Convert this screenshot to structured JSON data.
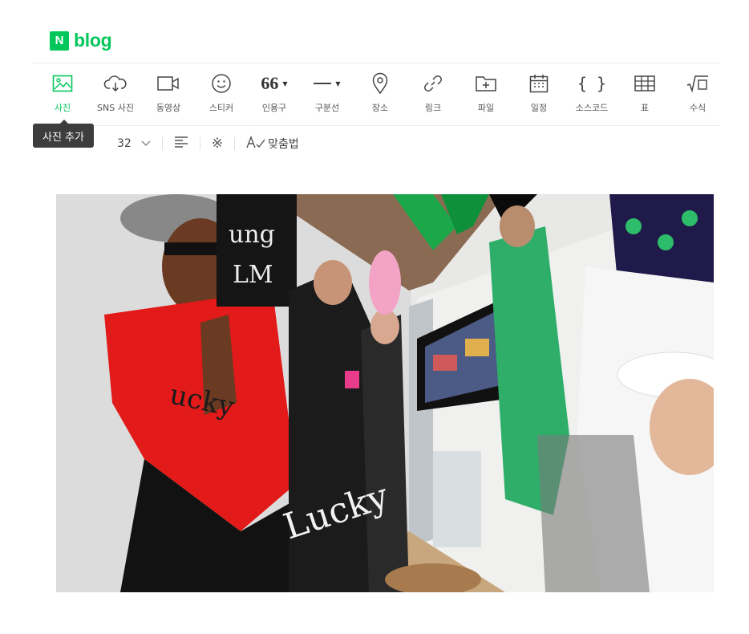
{
  "header": {
    "logo_mark": "N",
    "logo_text": "blog"
  },
  "toolbar": {
    "items": [
      {
        "label": "사진",
        "icon": "image-icon",
        "active": true
      },
      {
        "label": "SNS 사진",
        "icon": "cloud-download-icon"
      },
      {
        "label": "동영상",
        "icon": "video-camera-icon"
      },
      {
        "label": "스티커",
        "icon": "smiley-icon"
      },
      {
        "label": "인용구",
        "icon": "quote-icon",
        "glyph": "66"
      },
      {
        "label": "구분선",
        "icon": "horizontal-line-icon"
      },
      {
        "label": "장소",
        "icon": "map-pin-icon"
      },
      {
        "label": "링크",
        "icon": "link-icon"
      },
      {
        "label": "파일",
        "icon": "folder-plus-icon"
      },
      {
        "label": "일정",
        "icon": "calendar-icon"
      },
      {
        "label": "소스코드",
        "icon": "code-braces-icon",
        "glyph": "{ }"
      },
      {
        "label": "표",
        "icon": "table-icon"
      },
      {
        "label": "수식",
        "icon": "formula-icon"
      }
    ]
  },
  "tooltip": {
    "text": "사진 추가"
  },
  "format_bar": {
    "font_size": "32",
    "spellcheck_label": "맞춤법"
  },
  "colors": {
    "brand": "#03c75a",
    "tooltip_bg": "#3d3d3d"
  }
}
